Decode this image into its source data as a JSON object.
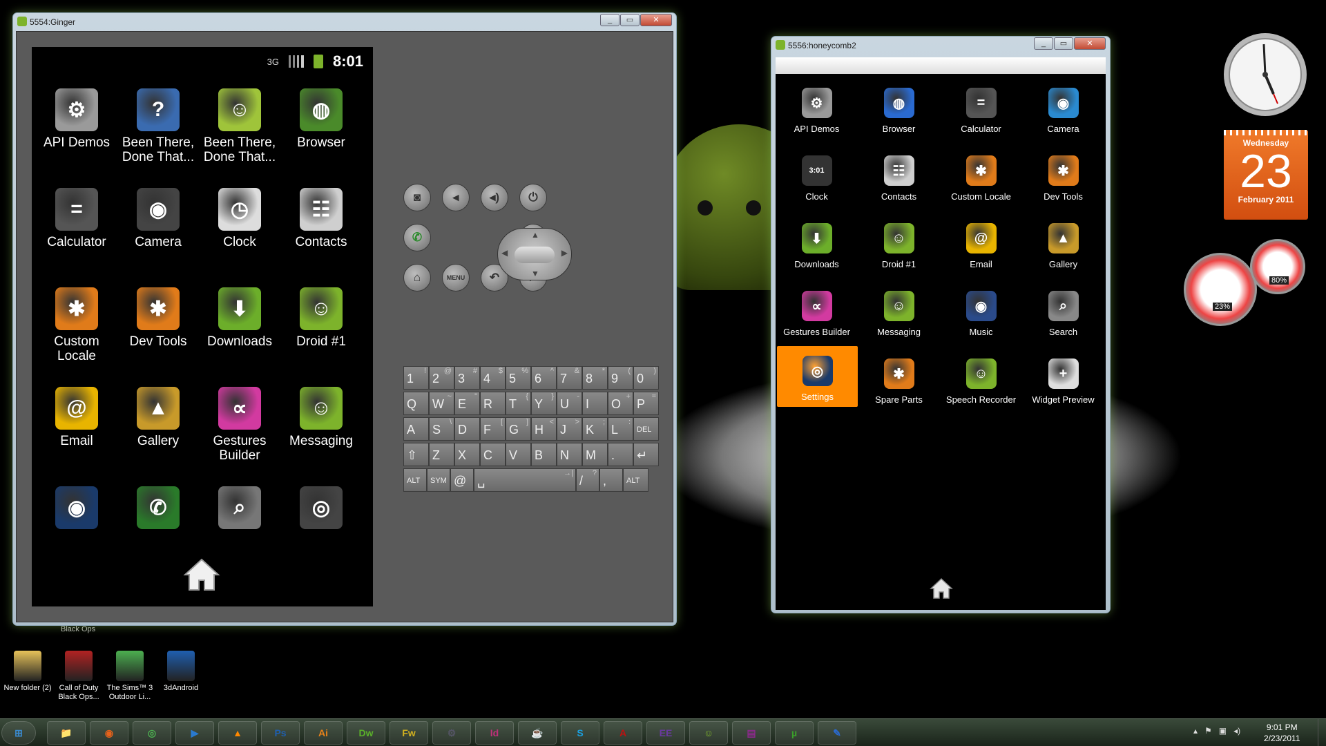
{
  "desktop": {
    "stray_text": "Black Ops",
    "icons": [
      {
        "label": "New folder (2)",
        "icon": "folder-icon",
        "color": "#e8c35a"
      },
      {
        "label": "Call of Duty Black Ops...",
        "icon": "skull-icon",
        "color": "#b22222"
      },
      {
        "label": "The Sims™ 3 Outdoor Li...",
        "icon": "sims-icon",
        "color": "#4caf50"
      },
      {
        "label": "3dAndroid",
        "icon": "psd-file-icon",
        "color": "#1f5fb0"
      }
    ]
  },
  "emulator_ginger": {
    "title": "5554:Ginger",
    "status": {
      "network": "3G",
      "time": "8:01"
    },
    "apps": [
      {
        "label": "API Demos",
        "icon": "folder-gear-icon",
        "color": "#9a9a9a"
      },
      {
        "label": "Been There, Done That...",
        "icon": "globe-question-icon",
        "color": "#3a6bb0"
      },
      {
        "label": "Been There, Done That...",
        "icon": "android-robot-icon",
        "color": "#9fc43a"
      },
      {
        "label": "Browser",
        "icon": "globe-icon",
        "color": "#4a8a2a"
      },
      {
        "label": "Calculator",
        "icon": "calculator-icon",
        "color": "#555555"
      },
      {
        "label": "Camera",
        "icon": "camera-lens-icon",
        "color": "#444444"
      },
      {
        "label": "Clock",
        "icon": "clock-icon",
        "color": "#dddddd"
      },
      {
        "label": "Contacts",
        "icon": "contacts-icon",
        "color": "#cfcfcf"
      },
      {
        "label": "Custom Locale",
        "icon": "gear-orange-icon",
        "color": "#e07b1a"
      },
      {
        "label": "Dev Tools",
        "icon": "gear-orange-icon",
        "color": "#e07b1a"
      },
      {
        "label": "Downloads",
        "icon": "download-arrow-icon",
        "color": "#6cae2a"
      },
      {
        "label": "Droid #1",
        "icon": "droid-card-icon",
        "color": "#7db32b"
      },
      {
        "label": "Email",
        "icon": "envelope-icon",
        "color": "#e8b400"
      },
      {
        "label": "Gallery",
        "icon": "gallery-icon",
        "color": "#c89a2a"
      },
      {
        "label": "Gestures Builder",
        "icon": "gestures-icon",
        "color": "#d23aa0"
      },
      {
        "label": "Messaging",
        "icon": "message-icon",
        "color": "#7db32b"
      },
      {
        "label": "",
        "icon": "music-speaker-icon",
        "color": "#1a3a6a"
      },
      {
        "label": "",
        "icon": "phone-icon",
        "color": "#2a7a2a"
      },
      {
        "label": "",
        "icon": "search-icon",
        "color": "#777777"
      },
      {
        "label": "",
        "icon": "settings-icon",
        "color": "#444444"
      }
    ],
    "hw_buttons": [
      {
        "name": "camera-button",
        "icon": "camera-icon",
        "glyph": "◙"
      },
      {
        "name": "volume-down-button",
        "icon": "volume-down-icon",
        "glyph": "◂"
      },
      {
        "name": "volume-up-button",
        "icon": "volume-up-icon",
        "glyph": "◂)"
      },
      {
        "name": "power-button",
        "icon": "power-icon",
        "glyph": "⏻"
      },
      {
        "name": "call-button",
        "icon": "call-icon",
        "glyph": "✆"
      },
      {
        "name": "end-call-button",
        "icon": "end-call-icon",
        "glyph": "✆"
      },
      {
        "name": "home-button",
        "icon": "home-icon",
        "glyph": "⌂"
      },
      {
        "name": "menu-button",
        "icon": "menu-icon",
        "glyph": "MENU"
      },
      {
        "name": "back-button",
        "icon": "back-icon",
        "glyph": "↶"
      },
      {
        "name": "search-button",
        "icon": "search-icon",
        "glyph": "⌕"
      }
    ],
    "keyboard": [
      [
        {
          "k": "1",
          "s": "!"
        },
        {
          "k": "2",
          "s": "@"
        },
        {
          "k": "3",
          "s": "#"
        },
        {
          "k": "4",
          "s": "$"
        },
        {
          "k": "5",
          "s": "%"
        },
        {
          "k": "6",
          "s": "^"
        },
        {
          "k": "7",
          "s": "&"
        },
        {
          "k": "8",
          "s": "*"
        },
        {
          "k": "9",
          "s": "("
        },
        {
          "k": "0",
          "s": ")"
        }
      ],
      [
        {
          "k": "Q",
          "s": ""
        },
        {
          "k": "W",
          "s": "~"
        },
        {
          "k": "E",
          "s": "\""
        },
        {
          "k": "R",
          "s": ""
        },
        {
          "k": "T",
          "s": "{"
        },
        {
          "k": "Y",
          "s": "}"
        },
        {
          "k": "U",
          "s": "-"
        },
        {
          "k": "I",
          "s": ""
        },
        {
          "k": "O",
          "s": "+"
        },
        {
          "k": "P",
          "s": "="
        }
      ],
      [
        {
          "k": "A",
          "s": ""
        },
        {
          "k": "S",
          "s": "\\"
        },
        {
          "k": "D",
          "s": ""
        },
        {
          "k": "F",
          "s": "["
        },
        {
          "k": "G",
          "s": "]"
        },
        {
          "k": "H",
          "s": "<"
        },
        {
          "k": "J",
          "s": ">"
        },
        {
          "k": "K",
          "s": ";"
        },
        {
          "k": "L",
          "s": ":"
        },
        {
          "k": "DEL",
          "s": ""
        }
      ],
      [
        {
          "k": "⇧",
          "s": ""
        },
        {
          "k": "Z",
          "s": ""
        },
        {
          "k": "X",
          "s": ""
        },
        {
          "k": "C",
          "s": ""
        },
        {
          "k": "V",
          "s": ""
        },
        {
          "k": "B",
          "s": ""
        },
        {
          "k": "N",
          "s": ""
        },
        {
          "k": "M",
          "s": ""
        },
        {
          "k": ".",
          "s": ""
        },
        {
          "k": "↵",
          "s": ""
        }
      ],
      [
        {
          "k": "ALT",
          "s": ""
        },
        {
          "k": "SYM",
          "s": ""
        },
        {
          "k": "@",
          "s": ""
        },
        {
          "k": "␣",
          "s": "→|"
        },
        {
          "k": "/",
          "s": "?"
        },
        {
          "k": ",",
          "s": ""
        },
        {
          "k": "ALT",
          "s": ""
        }
      ]
    ]
  },
  "emulator_honeycomb": {
    "title": "5556:honeycomb2",
    "apps": [
      {
        "label": "API Demos",
        "icon": "folder-gear-icon",
        "color": "#9a9a9a"
      },
      {
        "label": "Browser",
        "icon": "globe-icon",
        "color": "#2a6ad0"
      },
      {
        "label": "Calculator",
        "icon": "calculator-icon",
        "color": "#555555"
      },
      {
        "label": "Camera",
        "icon": "camera-lens-icon",
        "color": "#2a8ad0"
      },
      {
        "label": "Clock",
        "icon": "digital-clock-icon",
        "color": "#333333"
      },
      {
        "label": "Contacts",
        "icon": "contacts-icon",
        "color": "#cfcfcf"
      },
      {
        "label": "Custom Locale",
        "icon": "gear-orange-icon",
        "color": "#e07b1a"
      },
      {
        "label": "Dev Tools",
        "icon": "gear-orange-icon",
        "color": "#e07b1a"
      },
      {
        "label": "Downloads",
        "icon": "download-arrow-icon",
        "color": "#6cae2a"
      },
      {
        "label": "Droid #1",
        "icon": "droid-card-icon",
        "color": "#7db32b"
      },
      {
        "label": "Email",
        "icon": "envelope-icon",
        "color": "#e8b400"
      },
      {
        "label": "Gallery",
        "icon": "gallery-icon",
        "color": "#c89a2a"
      },
      {
        "label": "Gestures Builder",
        "icon": "gestures-icon",
        "color": "#d23aa0"
      },
      {
        "label": "Messaging",
        "icon": "message-icon",
        "color": "#7db32b"
      },
      {
        "label": "Music",
        "icon": "music-speaker-icon",
        "color": "#2a4a8a"
      },
      {
        "label": "Search",
        "icon": "search-icon",
        "color": "#888888"
      },
      {
        "label": "Settings",
        "icon": "settings-icon",
        "color": "#1a3a6a",
        "selected": true
      },
      {
        "label": "Spare Parts",
        "icon": "gear-orange-icon",
        "color": "#e07b1a"
      },
      {
        "label": "Speech Recorder",
        "icon": "droid-card-icon",
        "color": "#7db32b"
      },
      {
        "label": "Widget Preview",
        "icon": "widget-preview-icon",
        "color": "#dddddd"
      }
    ],
    "highlight_color": "#ff8a00"
  },
  "gadgets": {
    "calendar": {
      "day_name": "Wednesday",
      "day": "23",
      "month_year": "February 2011",
      "color": "#e8621a"
    },
    "meters": {
      "cpu": "23%",
      "memory": "80%"
    }
  },
  "taskbar": {
    "pinned": [
      {
        "name": "start-button",
        "icon": "windows-orb-icon",
        "text": "⊞",
        "color": "#3a8ad0"
      },
      {
        "name": "explorer",
        "icon": "folder-icon",
        "text": "📁",
        "color": "#e8c35a"
      },
      {
        "name": "firefox",
        "icon": "firefox-icon",
        "text": "◉",
        "color": "#e8621a"
      },
      {
        "name": "chrome",
        "icon": "chrome-icon",
        "text": "◎",
        "color": "#4caf50"
      },
      {
        "name": "media-player",
        "icon": "media-player-icon",
        "text": "▶",
        "color": "#2a7ad0"
      },
      {
        "name": "vlc",
        "icon": "vlc-cone-icon",
        "text": "▲",
        "color": "#ff8800"
      },
      {
        "name": "photoshop",
        "icon": "photoshop-icon",
        "text": "Ps",
        "color": "#1f5fb0"
      },
      {
        "name": "illustrator",
        "icon": "illustrator-icon",
        "text": "Ai",
        "color": "#e8821a"
      },
      {
        "name": "dreamweaver",
        "icon": "dreamweaver-icon",
        "text": "Dw",
        "color": "#5ab02a"
      },
      {
        "name": "fireworks",
        "icon": "fireworks-icon",
        "text": "Fw",
        "color": "#d0b020"
      },
      {
        "name": "steam",
        "icon": "steam-icon",
        "text": "⚙",
        "color": "#556"
      },
      {
        "name": "indesign",
        "icon": "indesign-icon",
        "text": "Id",
        "color": "#c0307a"
      },
      {
        "name": "java",
        "icon": "java-icon",
        "text": "☕",
        "color": "#d06020"
      },
      {
        "name": "skype",
        "icon": "skype-icon",
        "text": "S",
        "color": "#1aa0e0"
      },
      {
        "name": "acrobat",
        "icon": "acrobat-icon",
        "text": "A",
        "color": "#c01010"
      },
      {
        "name": "java-ee",
        "icon": "java-ee-icon",
        "text": "EE",
        "color": "#6a3aa0"
      },
      {
        "name": "android-sdk",
        "icon": "android-robot-icon",
        "text": "☺",
        "color": "#7db32b"
      },
      {
        "name": "winrar",
        "icon": "winrar-icon",
        "text": "▤",
        "color": "#8a2a8a"
      },
      {
        "name": "utorrent",
        "icon": "utorrent-icon",
        "text": "µ",
        "color": "#3aa02a"
      },
      {
        "name": "paint",
        "icon": "paint-icon",
        "text": "✎",
        "color": "#2a6ad0"
      }
    ],
    "clock_time": "9:01 PM",
    "clock_date": "2/23/2011"
  }
}
